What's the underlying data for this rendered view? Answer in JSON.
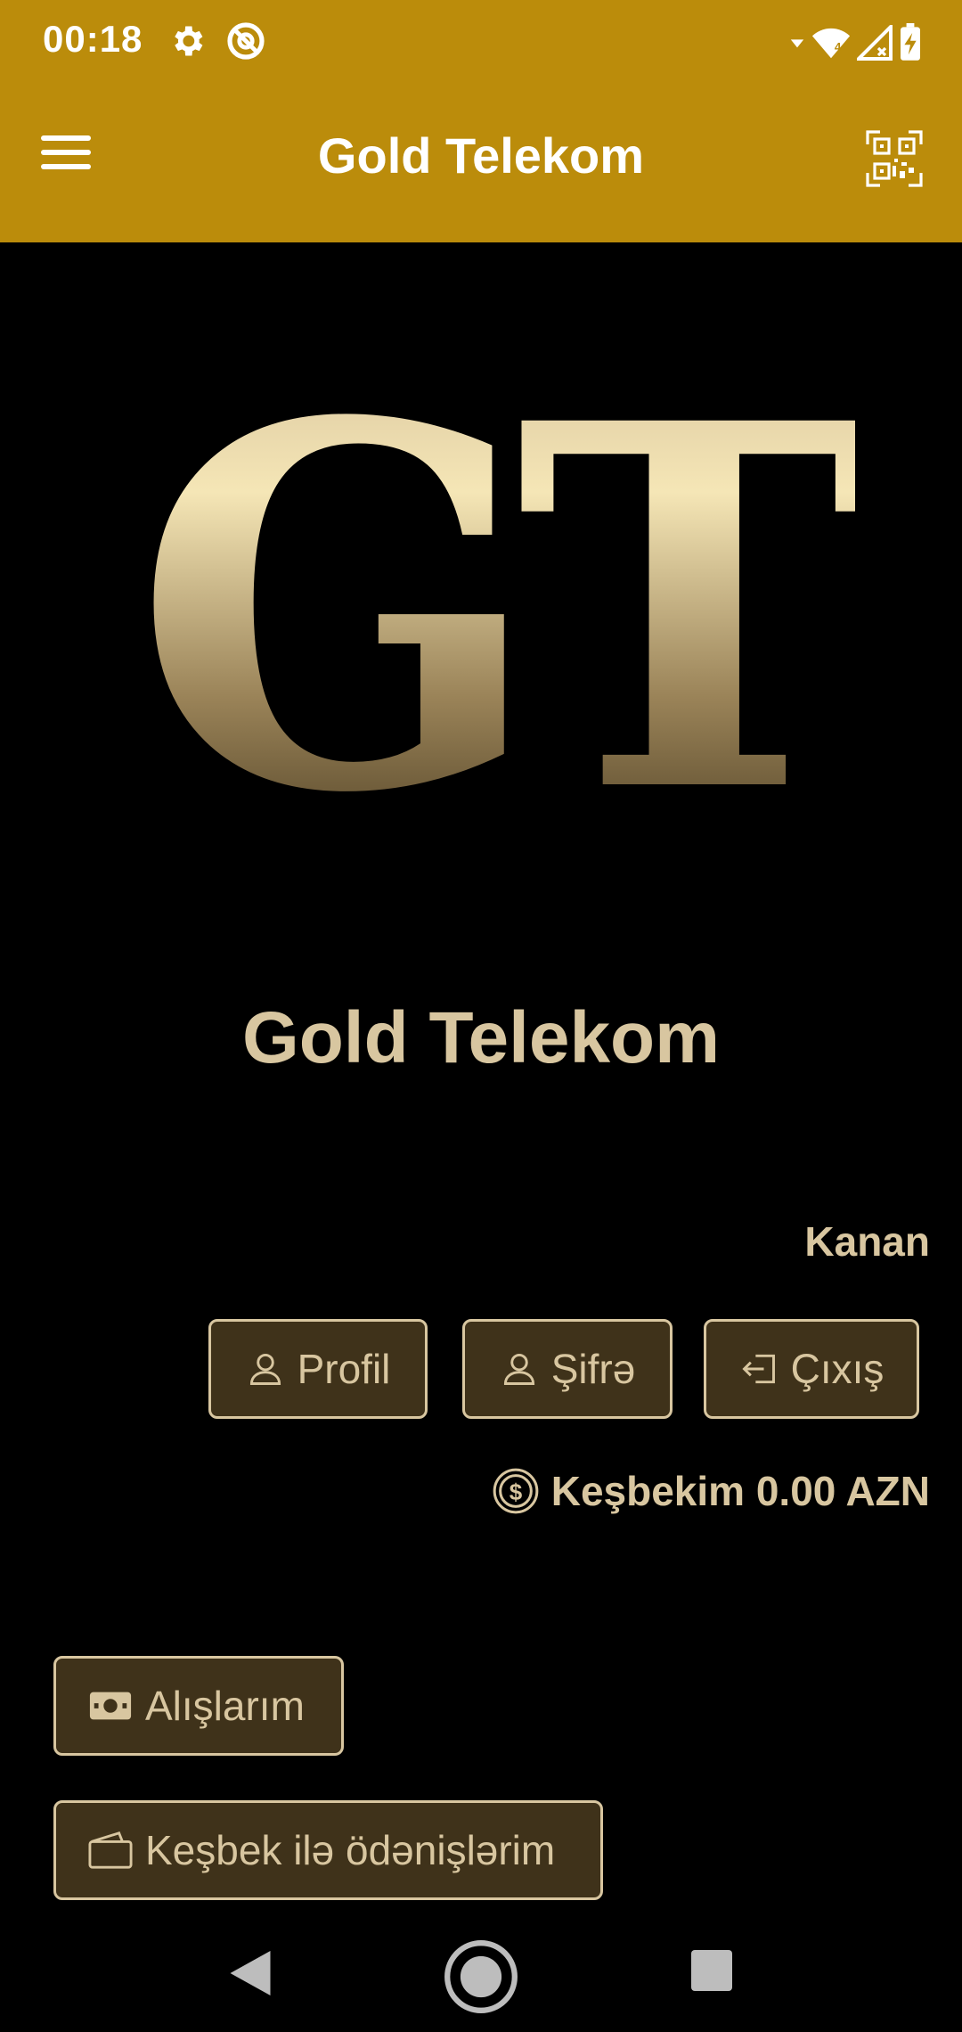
{
  "status_bar": {
    "time": "00:18"
  },
  "app_bar": {
    "title": "Gold Telekom"
  },
  "logo": {
    "text": "GT"
  },
  "brand_name": "Gold Telekom",
  "user": {
    "name": "Kanan"
  },
  "account_buttons": {
    "profile": "Profil",
    "password": "Şifrə",
    "logout": "Çıxış"
  },
  "cashback": {
    "label": "Keşbekim 0.00 AZN"
  },
  "menu_buttons": {
    "purchases": "Alışlarım",
    "cashback_payments": "Keşbek ilə ödənişlərim"
  },
  "colors": {
    "accent": "#bb8c0b",
    "gold_text": "#d8c6a0",
    "button_bg": "#3f321a",
    "background": "#000000"
  }
}
